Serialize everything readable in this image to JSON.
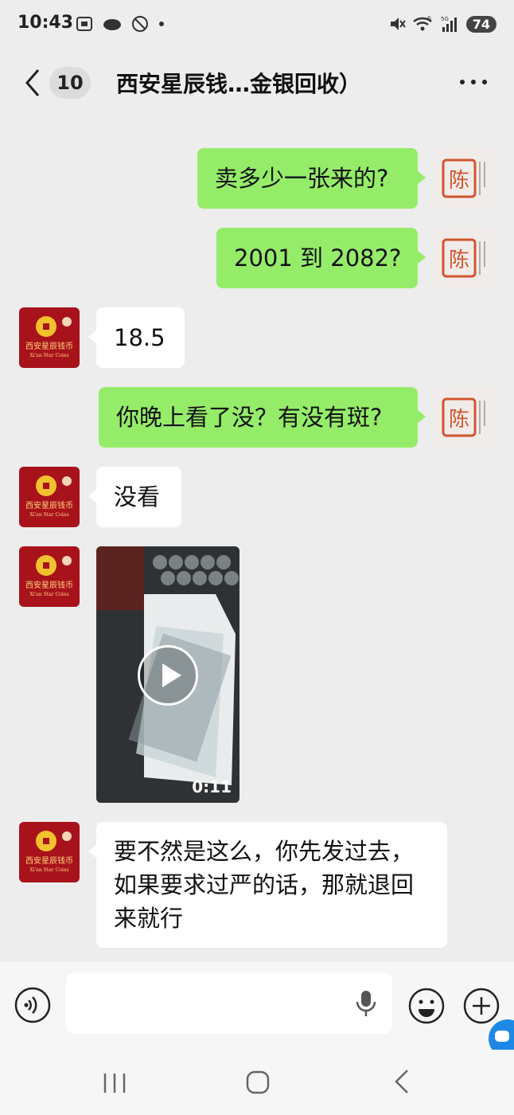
{
  "status_bar": {
    "time": "10:43",
    "battery": "74",
    "network_label": "5G",
    "signal_badge": "6"
  },
  "header": {
    "unread_count": "10",
    "title": "西安星辰钱…金银回收）"
  },
  "contacts": {
    "me_avatar_text": "陈",
    "shop_avatar_caption": "西安星辰钱币",
    "shop_avatar_caption_en": "Xi'an Star Coins"
  },
  "messages": [
    {
      "from": "me",
      "text": "卖多少一张来的?"
    },
    {
      "from": "me",
      "text": "2001 到 2082?"
    },
    {
      "from": "shop",
      "text": "18.5"
    },
    {
      "from": "me",
      "text": "你晚上看了没？有没有斑?"
    },
    {
      "from": "shop",
      "text": "没看"
    },
    {
      "from": "shop",
      "type": "video",
      "duration": "0:11"
    },
    {
      "from": "shop",
      "text": "要不然是这么，你先发过去，如果要求过严的话，那就退回来就行"
    }
  ],
  "colors": {
    "outgoing_bubble": "#95ec69",
    "incoming_bubble": "#ffffff",
    "background": "#ededed"
  },
  "icons": [
    "back-icon",
    "more-icon",
    "voice-icon",
    "microphone-icon",
    "emoji-icon",
    "plus-icon",
    "play-icon"
  ]
}
